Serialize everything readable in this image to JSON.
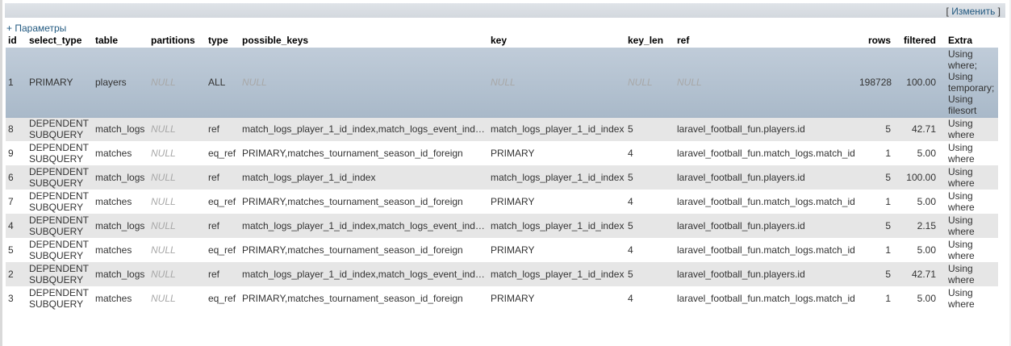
{
  "toolbar": {
    "edit_label": "Изменить",
    "bracket_open": "[ ",
    "bracket_close": " ]"
  },
  "params_label": "+ Параметры",
  "columns": [
    "id",
    "select_type",
    "table",
    "partitions",
    "type",
    "possible_keys",
    "key",
    "key_len",
    "ref",
    "rows",
    "filtered",
    "Extra"
  ],
  "rows": [
    {
      "id": "1",
      "select_type": "PRIMARY",
      "table": "players",
      "partitions": "NULL",
      "type": "ALL",
      "possible_keys": "NULL",
      "key": "NULL",
      "key_len": "NULL",
      "ref": "NULL",
      "rows": "198728",
      "filtered": "100.00",
      "extra": "Using where; Using temporary; Using filesort"
    },
    {
      "id": "8",
      "select_type": "DEPENDENT SUBQUERY",
      "table": "match_logs",
      "partitions": "NULL",
      "type": "ref",
      "possible_keys": "match_logs_player_1_id_index,match_logs_event_inde...",
      "key": "match_logs_player_1_id_index",
      "key_len": "5",
      "ref": "laravel_football_fun.players.id",
      "rows": "5",
      "filtered": "42.71",
      "extra": "Using where"
    },
    {
      "id": "9",
      "select_type": "DEPENDENT SUBQUERY",
      "table": "matches",
      "partitions": "NULL",
      "type": "eq_ref",
      "possible_keys": "PRIMARY,matches_tournament_season_id_foreign",
      "key": "PRIMARY",
      "key_len": "4",
      "ref": "laravel_football_fun.match_logs.match_id",
      "rows": "1",
      "filtered": "5.00",
      "extra": "Using where"
    },
    {
      "id": "6",
      "select_type": "DEPENDENT SUBQUERY",
      "table": "match_logs",
      "partitions": "NULL",
      "type": "ref",
      "possible_keys": "match_logs_player_1_id_index",
      "key": "match_logs_player_1_id_index",
      "key_len": "5",
      "ref": "laravel_football_fun.players.id",
      "rows": "5",
      "filtered": "100.00",
      "extra": "Using where"
    },
    {
      "id": "7",
      "select_type": "DEPENDENT SUBQUERY",
      "table": "matches",
      "partitions": "NULL",
      "type": "eq_ref",
      "possible_keys": "PRIMARY,matches_tournament_season_id_foreign",
      "key": "PRIMARY",
      "key_len": "4",
      "ref": "laravel_football_fun.match_logs.match_id",
      "rows": "1",
      "filtered": "5.00",
      "extra": "Using where"
    },
    {
      "id": "4",
      "select_type": "DEPENDENT SUBQUERY",
      "table": "match_logs",
      "partitions": "NULL",
      "type": "ref",
      "possible_keys": "match_logs_player_1_id_index,match_logs_event_inde...",
      "key": "match_logs_player_1_id_index",
      "key_len": "5",
      "ref": "laravel_football_fun.players.id",
      "rows": "5",
      "filtered": "2.15",
      "extra": "Using where"
    },
    {
      "id": "5",
      "select_type": "DEPENDENT SUBQUERY",
      "table": "matches",
      "partitions": "NULL",
      "type": "eq_ref",
      "possible_keys": "PRIMARY,matches_tournament_season_id_foreign",
      "key": "PRIMARY",
      "key_len": "4",
      "ref": "laravel_football_fun.match_logs.match_id",
      "rows": "1",
      "filtered": "5.00",
      "extra": "Using where"
    },
    {
      "id": "2",
      "select_type": "DEPENDENT SUBQUERY",
      "table": "match_logs",
      "partitions": "NULL",
      "type": "ref",
      "possible_keys": "match_logs_player_1_id_index,match_logs_event_inde...",
      "key": "match_logs_player_1_id_index",
      "key_len": "5",
      "ref": "laravel_football_fun.players.id",
      "rows": "5",
      "filtered": "42.71",
      "extra": "Using where"
    },
    {
      "id": "3",
      "select_type": "DEPENDENT SUBQUERY",
      "table": "matches",
      "partitions": "NULL",
      "type": "eq_ref",
      "possible_keys": "PRIMARY,matches_tournament_season_id_foreign",
      "key": "PRIMARY",
      "key_len": "4",
      "ref": "laravel_football_fun.match_logs.match_id",
      "rows": "1",
      "filtered": "5.00",
      "extra": "Using where"
    }
  ]
}
